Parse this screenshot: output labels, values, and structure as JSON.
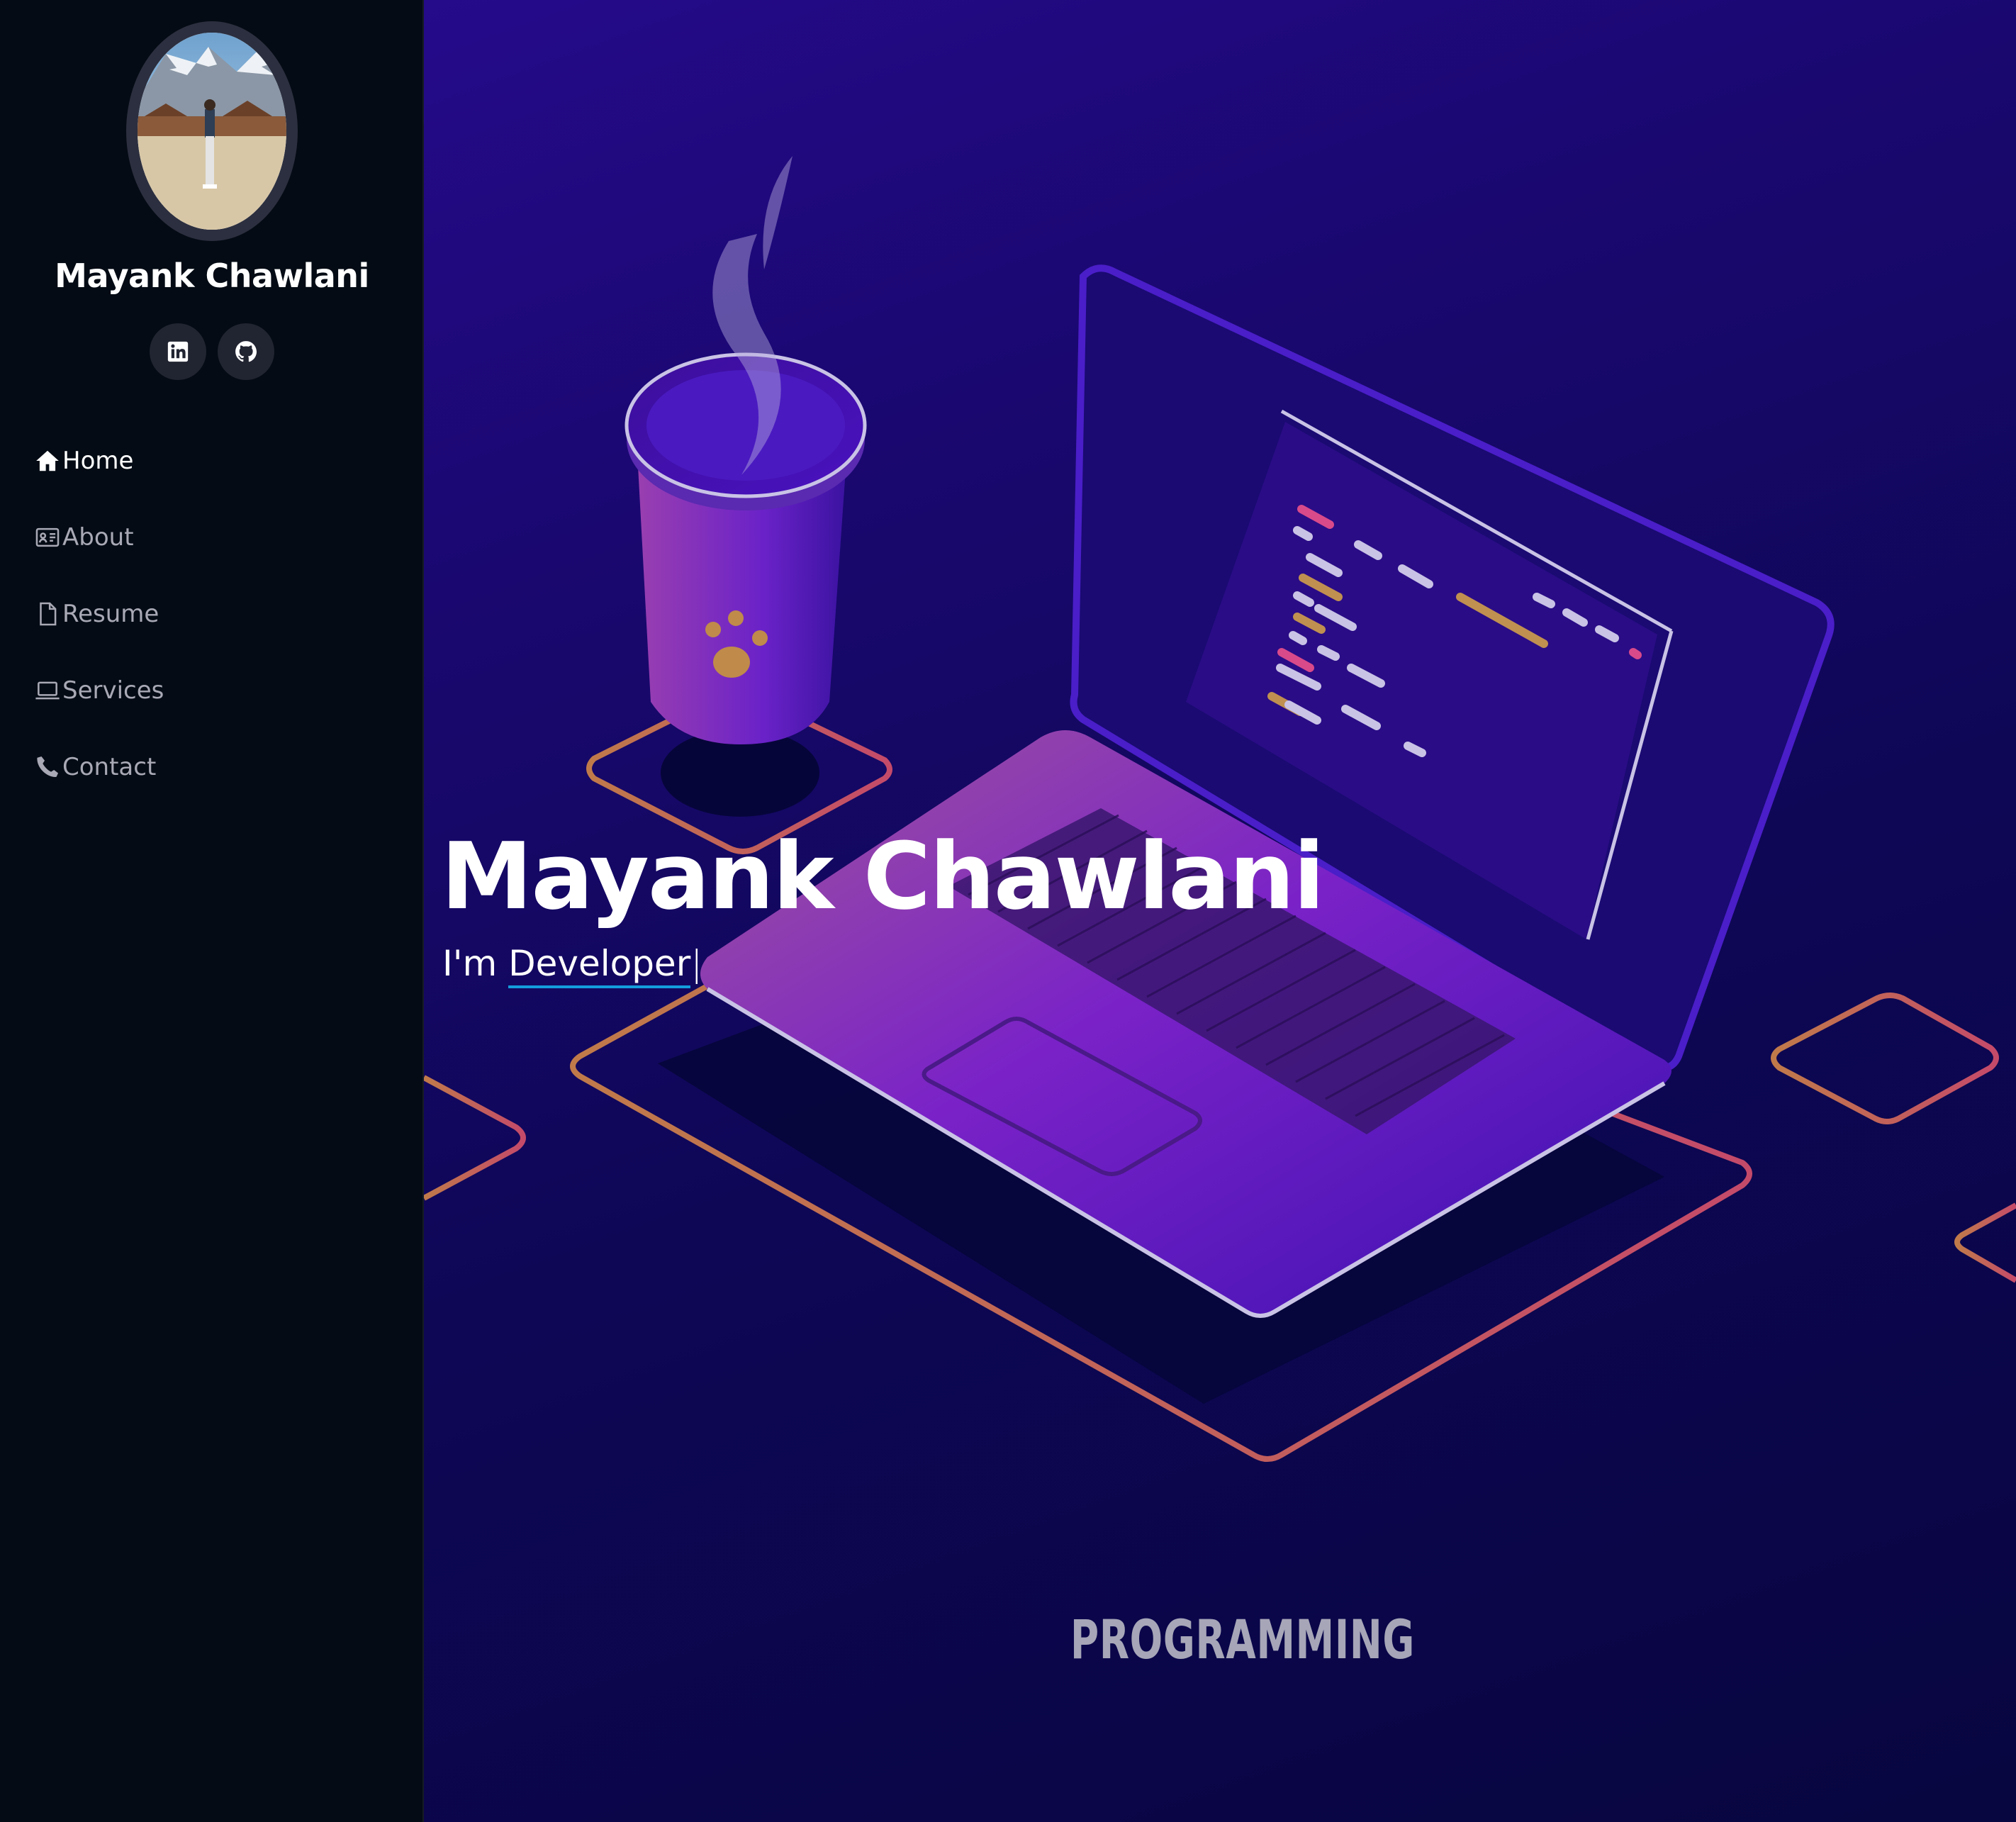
{
  "sidebar": {
    "profile_name": "Mayank Chawlani",
    "avatar": "profile-photo",
    "socials": [
      {
        "name": "linkedin",
        "icon": "linkedin-icon"
      },
      {
        "name": "github",
        "icon": "github-icon"
      }
    ],
    "nav": [
      {
        "label": "Home",
        "icon": "home-icon",
        "active": true
      },
      {
        "label": "About",
        "icon": "id-card-icon",
        "active": false
      },
      {
        "label": "Resume",
        "icon": "file-icon",
        "active": false
      },
      {
        "label": "Services",
        "icon": "laptop-icon",
        "active": false
      },
      {
        "label": "Contact",
        "icon": "phone-icon",
        "active": false
      }
    ]
  },
  "hero": {
    "title": "Mayank Chawlani",
    "subtitle_prefix": "I'm ",
    "subtitle_typed": "Developer",
    "cursor": "|",
    "illustration_caption": "PROGRAMMING"
  },
  "colors": {
    "sidebar_bg": "#040b14",
    "nav_active": "#ffffff",
    "nav_inactive": "#a8a9b4",
    "accent_underline": "#149ddd",
    "hero_bg_top": "#250a8a",
    "hero_bg_bottom": "#080640"
  }
}
